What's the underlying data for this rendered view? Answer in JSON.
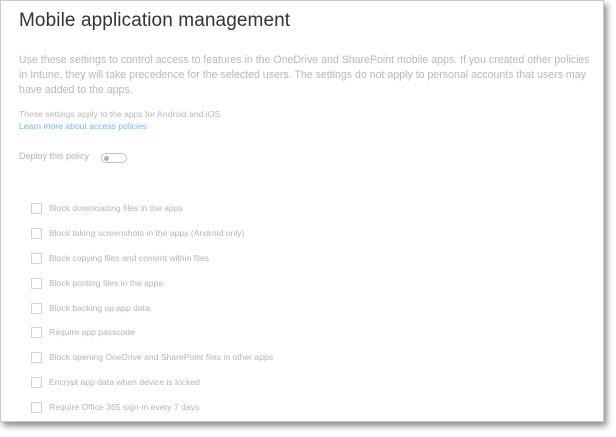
{
  "page": {
    "title": "Mobile application management",
    "description": "Use these settings to control access to features in the OneDrive and SharePoint mobile apps. If you created other policies in Intune, they will take precedence for the selected users. The settings do not apply to personal accounts that users may have added to the apps.",
    "applies_note": "These settings apply to the apps for Android and iOS.",
    "learn_more_link": "Learn more about access policies"
  },
  "deploy": {
    "label": "Deploy this policy",
    "enabled": false
  },
  "options": [
    {
      "label": "Block downloading files in the apps",
      "checked": false
    },
    {
      "label": "Block taking screenshots in the apps (Android only)",
      "checked": false
    },
    {
      "label": "Block copying files and content within files",
      "checked": false
    },
    {
      "label": "Block printing files in the apps",
      "checked": false
    },
    {
      "label": "Block backing up app data",
      "checked": false
    },
    {
      "label": "Require app passcode",
      "checked": false
    },
    {
      "label": "Block opening OneDrive and SharePoint files in other apps",
      "checked": false
    },
    {
      "label": "Encrypt app data when device is locked",
      "checked": false
    },
    {
      "label": "Require Office 365 sign-in every 7 days",
      "checked": false
    }
  ],
  "colors": {
    "title_text": "#333333",
    "disabled_text": "#b5b5b5",
    "link": "#7fb4e3"
  }
}
